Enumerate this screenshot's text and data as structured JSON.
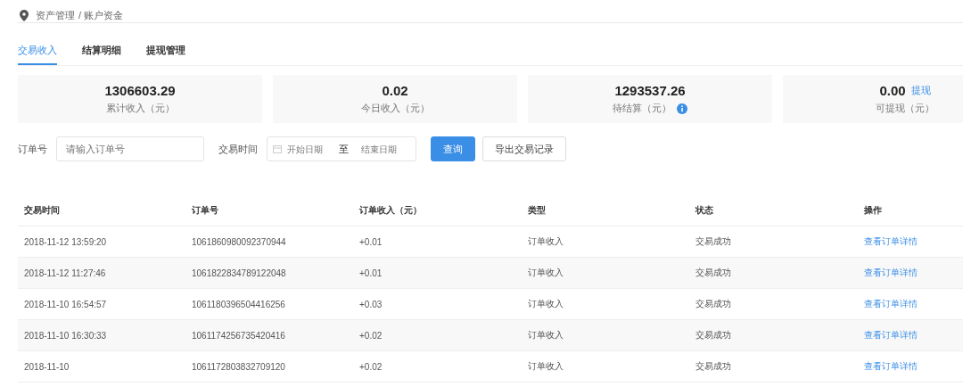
{
  "breadcrumb": [
    "资产管理",
    "/ 账户资金"
  ],
  "tabs": [
    {
      "label": "交易收入",
      "selected": true
    },
    {
      "label": "结算明细",
      "selected": false
    },
    {
      "label": "提现管理",
      "selected": false
    }
  ],
  "stats": [
    {
      "value": "1306603.29",
      "label": "累计收入（元）"
    },
    {
      "value": "0.02",
      "label": "今日收入（元）"
    },
    {
      "value": "1293537.26",
      "label": "待结算（元）",
      "info": true
    },
    {
      "value": "0.00",
      "label": "可提现（元）",
      "link": "提现"
    }
  ],
  "filters": {
    "order_label": "订单号",
    "order_placeholder": "请输入订单号",
    "time_label": "交易时间",
    "start_placeholder": "开始日期",
    "range_separator": "至",
    "end_placeholder": "结束日期",
    "search_button": "查询",
    "export_button": "导出交易记录"
  },
  "table": {
    "columns": [
      "交易时间",
      "订单号",
      "订单收入（元）",
      "类型",
      "状态",
      "操作"
    ],
    "rows": [
      {
        "time": "2018-11-12 13:59:20",
        "order": "1061860980092370944",
        "income": "+0.01",
        "type": "订单收入",
        "status": "交易成功",
        "action": "查看订单详情"
      },
      {
        "time": "2018-11-12 11:27:46",
        "order": "1061822834789122048",
        "income": "+0.01",
        "type": "订单收入",
        "status": "交易成功",
        "action": "查看订单详情"
      },
      {
        "time": "2018-11-10 16:54:57",
        "order": "1061180396504416256",
        "income": "+0.03",
        "type": "订单收入",
        "status": "交易成功",
        "action": "查看订单详情"
      },
      {
        "time": "2018-11-10 16:30:33",
        "order": "1061174256735420416",
        "income": "+0.02",
        "type": "订单收入",
        "status": "交易成功",
        "action": "查看订单详情"
      },
      {
        "time": "2018-11-10",
        "order": "1061172803832709120",
        "income": "+0.02",
        "type": "订单收入",
        "status": "交易成功",
        "action": "查看订单详情"
      }
    ]
  }
}
